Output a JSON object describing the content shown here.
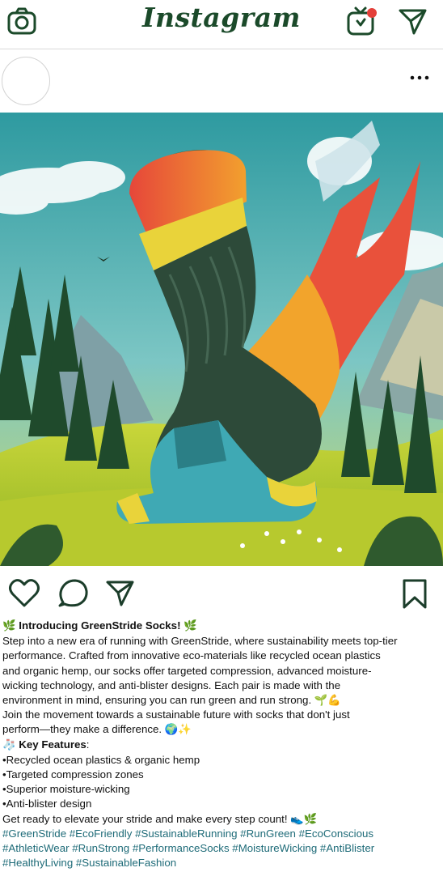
{
  "app": {
    "logo_text": "Instagram",
    "notification_dot_color": "#e4403a",
    "icon_color": "#1b4a2a"
  },
  "header_icons": [
    "camera-icon",
    "igtv-icon",
    "direct-message-icon"
  ],
  "post": {
    "menu_icon": "more-options-icon",
    "image_description_icon": "sock-illustration"
  },
  "action_icons": [
    "heart-icon",
    "comment-icon",
    "share-icon",
    "bookmark-icon"
  ],
  "caption": {
    "title_emoji_left": "🌿",
    "title": "Introducing GreenStride Socks!",
    "title_emoji_right": "🌿",
    "body_lines": [
      "Step into a new era of running with GreenStride, where sustainability meets top-tier",
      "performance. Crafted from innovative eco-materials like recycled ocean plastics",
      "and organic hemp, our socks offer targeted compression, advanced moisture-",
      "wicking technology, and anti-blister designs. Each pair is made with the",
      "environment in mind, ensuring you can run green and run strong. 🌱💪",
      "Join the movement towards a sustainable future with socks that don't just",
      "perform—they make a difference. 🌍✨"
    ],
    "features_emoji": "🧦",
    "features_title": "Key Features",
    "features_colon": ":",
    "features": [
      "•Recycled ocean plastics & organic hemp",
      "•Targeted compression zones",
      "•Superior moisture-wicking",
      "•Anti-blister design"
    ],
    "closing": "Get ready to elevate your stride and make every step count! 👟🌿",
    "hashtag_lines": [
      "#GreenStride #EcoFriendly #SustainableRunning #RunGreen #EcoConscious",
      "#AthleticWear #RunStrong #PerformanceSocks #MoistureWicking #AntiBlister",
      "#HealthyLiving #SustainableFashion"
    ]
  }
}
